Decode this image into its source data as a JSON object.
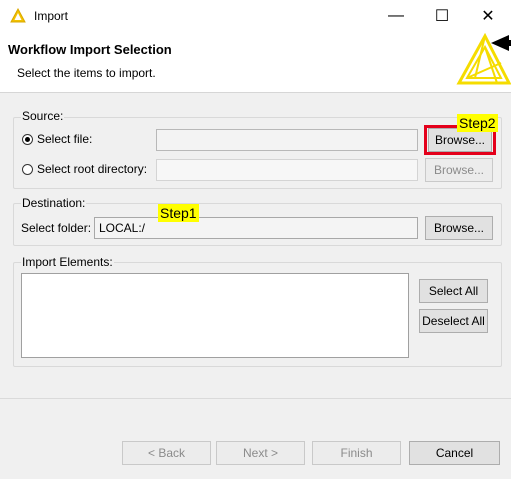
{
  "window": {
    "title": "Import",
    "minimize_glyph": "—",
    "maximize_glyph": "☐",
    "close_glyph": "✕"
  },
  "header": {
    "title": "Workflow Import Selection",
    "subtitle": "Select the items to import."
  },
  "source": {
    "label": "Source:",
    "select_file_label": "Select file:",
    "select_file_value": "",
    "select_file_browse": "Browse...",
    "select_root_label": "Select root directory:",
    "select_root_value": "",
    "select_root_browse": "Browse..."
  },
  "destination": {
    "label": "Destination:",
    "select_folder_label": "Select folder:",
    "select_folder_value": "LOCAL:/",
    "browse": "Browse..."
  },
  "import_elements": {
    "label": "Import Elements:",
    "select_all": "Select All",
    "deselect_all": "Deselect All"
  },
  "annotations": {
    "step1": "Step1",
    "step2": "Step2"
  },
  "footer": {
    "back": "< Back",
    "next": "Next >",
    "finish": "Finish",
    "cancel": "Cancel"
  },
  "colors": {
    "annotation_bg": "#ffff00",
    "highlight_border": "#e4001b",
    "logo": "#f5dc00"
  }
}
